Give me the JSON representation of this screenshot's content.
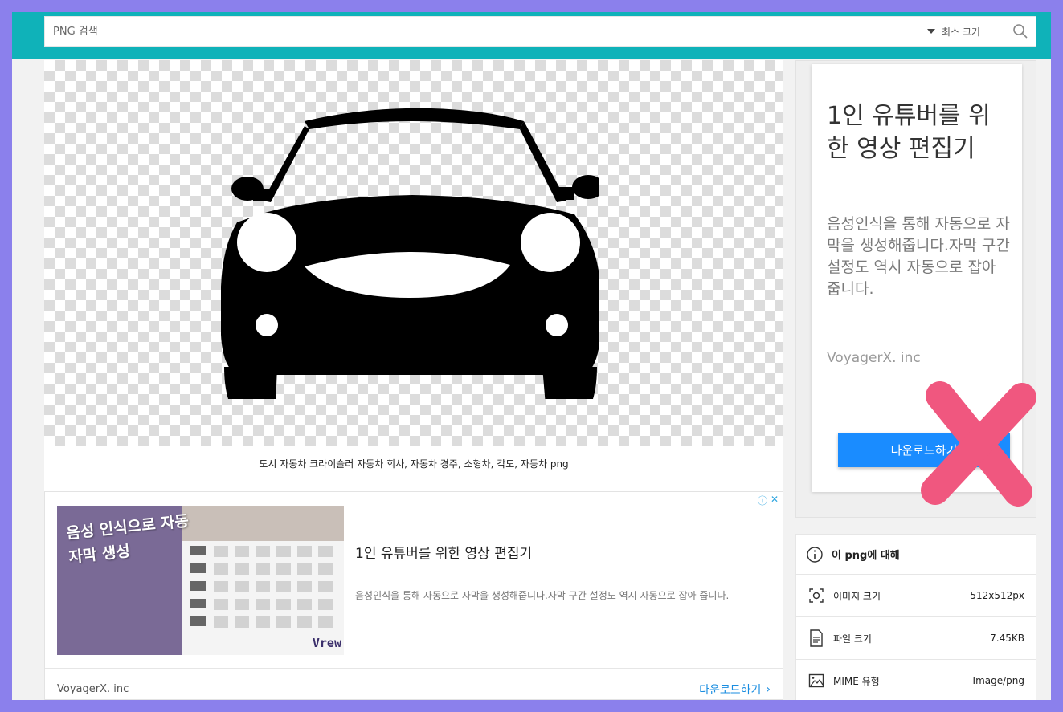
{
  "search": {
    "placeholder": "PNG 검색",
    "size_filter": "최소 크기"
  },
  "image": {
    "caption": "도시 자동차 크라이슬러 자동차 회사, 자동차 경주, 소형차, 각도, 자동차 png"
  },
  "ad_card": {
    "thumb_text": "음성 인식으로 자동 자막 생성",
    "thumb_logo": "Vrew",
    "title": "1인 유튜버를 위한 영상 편집기",
    "description": "음성인식을 통해 자동으로 자막을 생성해줍니다.자막 구간 설정도 역시 자동으로 잡아 줍니다.",
    "advertiser": "VoyagerX. inc",
    "download_label": "다운로드하기"
  },
  "side_ad": {
    "title": "1인 유튜버를 위한 영상 편집기",
    "description": "음성인식을 통해 자동으로 자막을 생성해줍니다.자막 구간 설정도 역시 자동으로 잡아 줍니다.",
    "advertiser": "VoyagerX. inc",
    "download_label": "다운로드하기",
    "close_mark_color": "#f0577f"
  },
  "info": {
    "heading": "이 png에 대해",
    "rows": [
      {
        "label": "이미지 크기",
        "value": "512x512px",
        "icon": "image-size-icon"
      },
      {
        "label": "파일 크기",
        "value": "7.45KB",
        "icon": "file-icon"
      },
      {
        "label": "MIME 유형",
        "value": "Image/png",
        "icon": "image-icon"
      }
    ]
  },
  "colors": {
    "header": "#0fb2b9",
    "outer_frame": "#8b80ec",
    "accent_button": "#1a8cff"
  }
}
